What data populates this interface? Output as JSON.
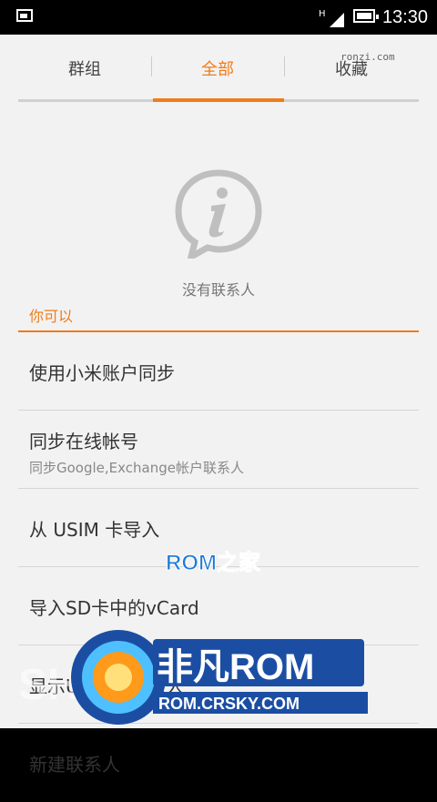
{
  "status": {
    "time": "13:30",
    "network": "H"
  },
  "tabs": [
    "群组",
    "全部",
    "收藏"
  ],
  "watermark": "ronzi.com",
  "empty": {
    "message": "没有联系人"
  },
  "section": {
    "title": "你可以"
  },
  "items": [
    {
      "title": "使用小米账户同步"
    },
    {
      "title": "同步在线帐号",
      "subtitle": "同步Google,Exchange帐户联系人"
    },
    {
      "title": "从 USIM 卡导入"
    },
    {
      "title": "导入SD卡中的vCard"
    },
    {
      "title": "显示USIM卡联系人"
    },
    {
      "title": "新建联系人"
    }
  ],
  "logos": {
    "rom_home": "ROM之家",
    "brand_name": "非凡ROM",
    "brand_url": "ROM.CRSKY.COM",
    "bg_text": "SHOW"
  },
  "colors": {
    "accent": "#f07c19",
    "brand_blue": "#1b4ea3"
  }
}
